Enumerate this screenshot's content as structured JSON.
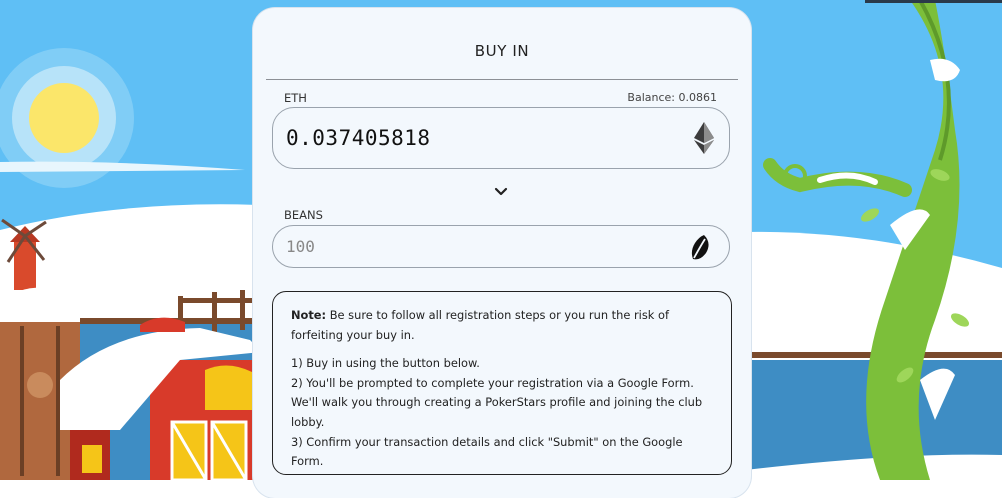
{
  "modal": {
    "title": "BUY IN",
    "eth": {
      "label": "ETH",
      "balance": "Balance: 0.0861",
      "value": "0.037405818",
      "icon": "ethereum-icon"
    },
    "swap_icon": "chevron-down-icon",
    "beans": {
      "label": "BEANS",
      "placeholder": "100",
      "icon": "bean-leaf-icon"
    },
    "note": {
      "heading": "Note:",
      "intro": "Be sure to follow all registration steps or you run the risk of forfeiting your buy in.",
      "steps": [
        "1) Buy in using the button below.",
        "2) You'll be prompted to complete your registration via a Google Form. We'll walk you through creating a PokerStars profile and joining the club lobby.",
        "3) Confirm your transaction details and click \"Submit\" on the Google Form."
      ]
    }
  },
  "colors": {
    "sky": "#5fbff5",
    "snow": "#ffffff",
    "barn_red": "#d83a2a",
    "beanstalk_green": "#7cbf3a",
    "sun": "#fbe66a",
    "water": "#3e8dc4"
  }
}
